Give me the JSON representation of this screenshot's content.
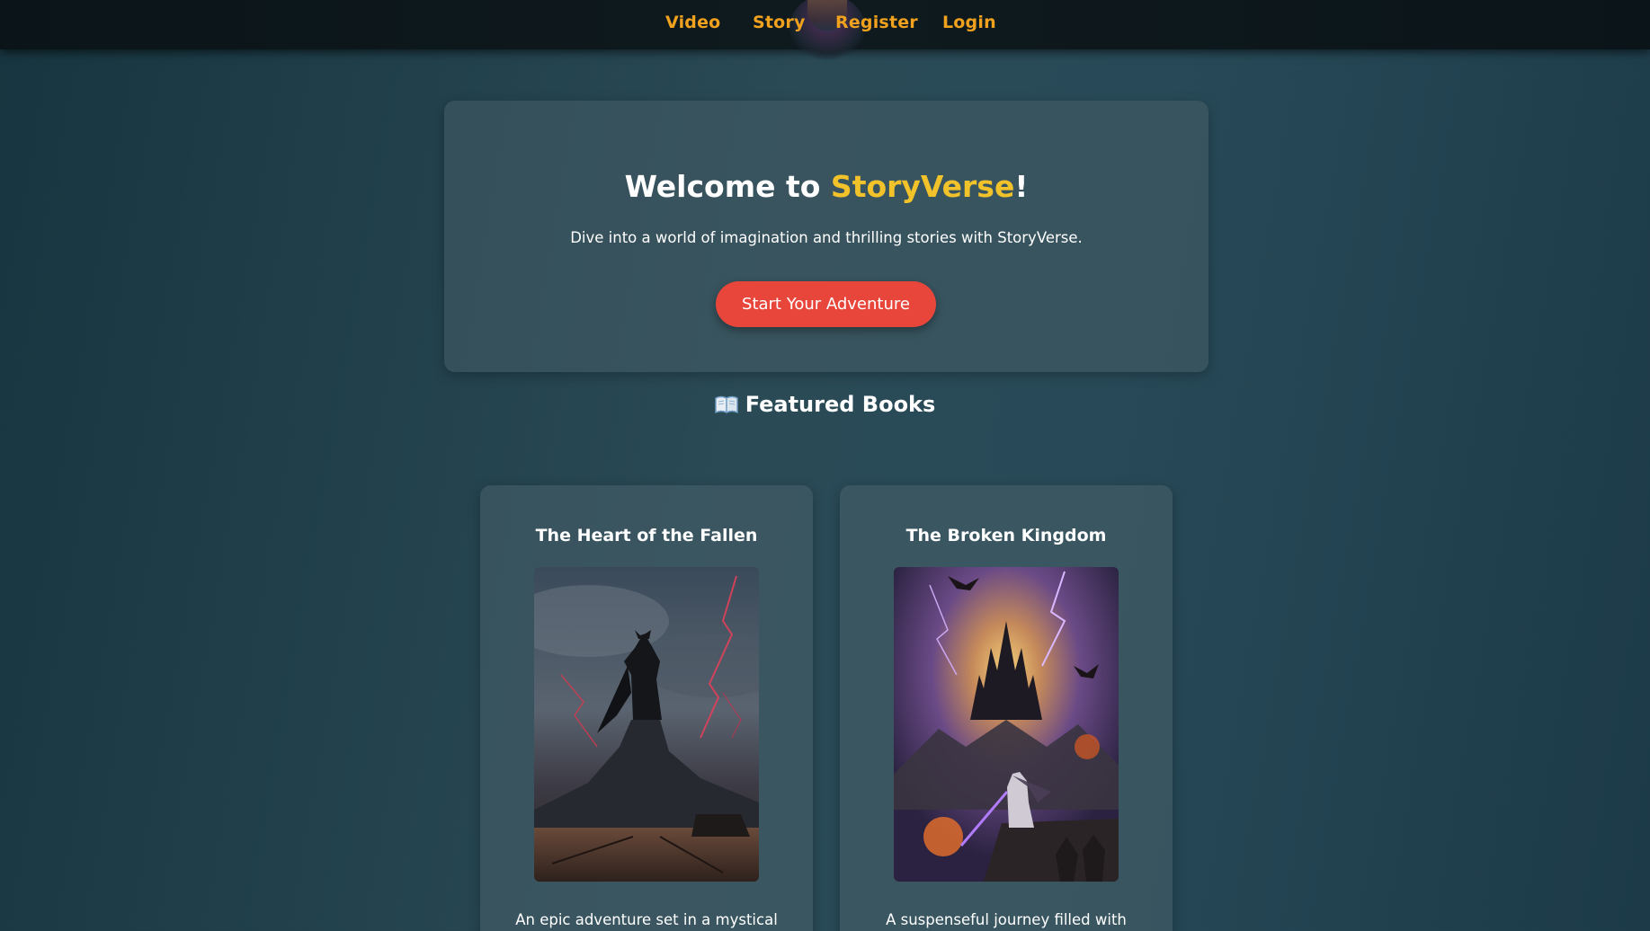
{
  "nav": {
    "links": [
      {
        "label": "Video"
      },
      {
        "label": "Story"
      },
      {
        "label": "Register"
      },
      {
        "label": "Login"
      }
    ]
  },
  "hero": {
    "title_prefix": "Welcome to ",
    "title_brand": "StoryVerse",
    "title_suffix": "!",
    "subtitle": "Dive into a world of imagination and thrilling stories with StoryVerse.",
    "button_label": "Start Your Adventure"
  },
  "featured": {
    "heading": "Featured Books",
    "books": [
      {
        "title": "The Heart of the Fallen",
        "description": "An epic adventure set in a mystical"
      },
      {
        "title": "The Broken Kingdom",
        "description": "A suspenseful journey filled with"
      }
    ]
  },
  "colors": {
    "accent_orange": "#f0a21f",
    "brand_yellow": "#f2c22b",
    "button_red": "#e8463a"
  }
}
